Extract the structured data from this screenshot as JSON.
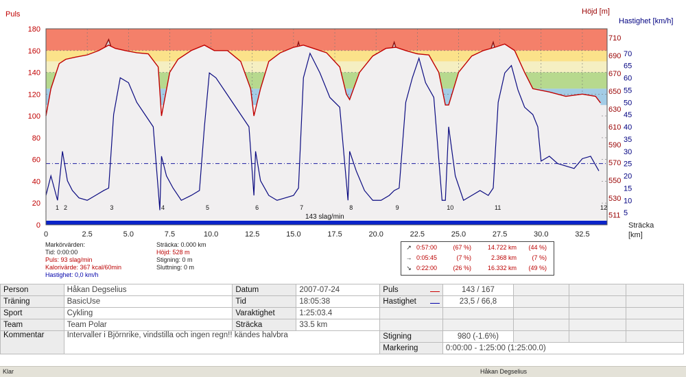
{
  "chart_data": {
    "type": "line",
    "left_axis": {
      "label": "Puls",
      "ticks": [
        0,
        20,
        40,
        60,
        80,
        100,
        120,
        140,
        160,
        180
      ],
      "range": [
        0,
        180
      ],
      "color": "#c00000"
    },
    "right_axis_height": {
      "label": "Höjd [m]",
      "ticks": [
        511,
        530,
        550,
        570,
        590,
        610,
        630,
        650,
        670,
        690,
        710
      ],
      "color": "#990000"
    },
    "right_axis_speed": {
      "label": "Hastighet [km/h]",
      "ticks": [
        5,
        10,
        15,
        20,
        25,
        30,
        35,
        40,
        45,
        50,
        55,
        60,
        65,
        70
      ],
      "range": [
        0,
        80
      ],
      "color": "#000080"
    },
    "x_axis": {
      "label": "Sträcka\n[km]",
      "ticks": [
        "0",
        "2.5",
        "5.0",
        "7.5",
        "10.0",
        "12.5",
        "15.0",
        "17.5",
        "20.0",
        "22.5",
        "25.0",
        "27.5",
        "30.0",
        "32.5"
      ],
      "range": [
        0,
        34
      ]
    },
    "hr_zones": [
      {
        "from": 160,
        "to": 180,
        "color": "#f4806a"
      },
      {
        "from": 150,
        "to": 160,
        "color": "#fbe28a"
      },
      {
        "from": 140,
        "to": 150,
        "color": "#f5efc2"
      },
      {
        "from": 125,
        "to": 140,
        "color": "#b7d98e"
      },
      {
        "from": 110,
        "to": 125,
        "color": "#a3cce6"
      }
    ],
    "average_speed": 25.0,
    "average_hr_label": "143 slag/min",
    "lap_labels": [
      "1",
      "2",
      "3",
      "4",
      "5",
      "6",
      "7",
      "8",
      "9",
      "10",
      "11",
      "12"
    ],
    "lap_positions_km": [
      0.5,
      1.0,
      3.8,
      6.9,
      9.6,
      12.6,
      15.3,
      18.3,
      21.1,
      24.2,
      27.1,
      33.5
    ],
    "altitude": {
      "x": [
        0,
        1,
        2,
        3.8,
        5,
        6.9,
        8,
        9.6,
        11,
        12.6,
        14,
        15.3,
        16.5,
        18.3,
        19.5,
        21.1,
        22.5,
        24.2,
        25.5,
        27.1,
        28.5,
        30,
        31,
        32,
        33,
        33.5
      ],
      "y": [
        515,
        580,
        640,
        708,
        640,
        515,
        620,
        700,
        620,
        515,
        620,
        705,
        620,
        515,
        620,
        705,
        620,
        515,
        620,
        705,
        610,
        515,
        511,
        511,
        512,
        512
      ]
    },
    "heart_rate": {
      "x": [
        0,
        0.3,
        0.8,
        1.2,
        1.8,
        2.5,
        3.2,
        3.8,
        4.2,
        4.8,
        5.5,
        6.2,
        6.8,
        7.0,
        7.5,
        8.0,
        8.8,
        9.6,
        10.2,
        11.0,
        11.8,
        12.4,
        12.6,
        13.0,
        13.5,
        14.2,
        15.0,
        15.6,
        16.2,
        17.0,
        17.8,
        18.2,
        18.4,
        19.0,
        19.8,
        20.6,
        21.2,
        21.8,
        22.5,
        23.2,
        23.8,
        24.2,
        24.4,
        25.0,
        25.8,
        26.5,
        27.2,
        27.8,
        28.4,
        29.0,
        29.5,
        30.5,
        31.5,
        32.5,
        33.3,
        33.6
      ],
      "y": [
        100,
        125,
        148,
        152,
        154,
        156,
        160,
        165,
        162,
        160,
        158,
        157,
        145,
        100,
        140,
        152,
        160,
        165,
        160,
        160,
        150,
        125,
        100,
        125,
        150,
        158,
        163,
        165,
        162,
        158,
        145,
        120,
        115,
        140,
        155,
        162,
        163,
        160,
        157,
        156,
        140,
        110,
        110,
        140,
        155,
        160,
        163,
        166,
        160,
        140,
        125,
        122,
        118,
        120,
        118,
        112
      ]
    },
    "speed": {
      "x": [
        0,
        0.3,
        0.7,
        1.0,
        1.3,
        1.6,
        2.0,
        2.5,
        3.0,
        3.5,
        3.8,
        4.1,
        4.5,
        5.0,
        5.5,
        6.0,
        6.5,
        6.9,
        7.0,
        7.3,
        7.7,
        8.2,
        8.8,
        9.3,
        9.6,
        9.9,
        10.3,
        10.8,
        11.3,
        11.8,
        12.3,
        12.6,
        12.7,
        13.0,
        13.5,
        14.0,
        14.5,
        15.0,
        15.3,
        15.6,
        16.0,
        16.6,
        17.2,
        17.8,
        18.3,
        18.4,
        18.8,
        19.3,
        19.8,
        20.3,
        20.8,
        21.1,
        21.4,
        21.8,
        22.2,
        22.6,
        23.0,
        23.5,
        24.0,
        24.2,
        24.4,
        24.8,
        25.3,
        25.8,
        26.3,
        26.8,
        27.1,
        27.4,
        27.8,
        28.2,
        28.6,
        29.0,
        29.5,
        29.8,
        30.0,
        30.5,
        31.0,
        31.5,
        32.0,
        32.5,
        33.0,
        33.5
      ],
      "y": [
        12,
        20,
        10,
        30,
        18,
        14,
        11,
        10,
        12,
        14,
        15,
        45,
        60,
        58,
        50,
        45,
        40,
        6,
        28,
        20,
        15,
        10,
        12,
        14,
        40,
        62,
        60,
        55,
        50,
        45,
        40,
        12,
        30,
        18,
        12,
        10,
        11,
        12,
        15,
        60,
        70,
        62,
        52,
        48,
        10,
        30,
        22,
        14,
        10,
        10,
        12,
        14,
        15,
        50,
        60,
        68,
        58,
        52,
        10,
        10,
        40,
        20,
        10,
        12,
        14,
        12,
        15,
        50,
        62,
        65,
        55,
        48,
        45,
        40,
        26,
        28,
        25,
        24,
        23,
        27,
        28,
        22
      ]
    }
  },
  "markers": {
    "title": "Markörvärden:",
    "time": "Tid: 0:00:00",
    "pulse": "Puls: 93 slag/min",
    "calories": "Kalorivärde: 367 kcal/60min",
    "speed": "Hastighet: 0,0 km/h"
  },
  "position_stats": {
    "distance": "Sträcka: 0.000 km",
    "height": "Höjd: 528 m",
    "climb": "Stigning: 0 m",
    "descent": "Sluttning: 0 m"
  },
  "gradient_summary": [
    {
      "icon": "up-arrow",
      "glyph": "↗",
      "time": "0:57:00",
      "pct": "(67 %)",
      "dist": "14.722 km",
      "dpct": "(44 %)"
    },
    {
      "icon": "right-arrow",
      "glyph": "→",
      "time": "0:05:45",
      "pct": "(7 %)",
      "dist": "2.368 km",
      "dpct": "(7 %)"
    },
    {
      "icon": "down-arrow",
      "glyph": "↘",
      "time": "0:22:00",
      "pct": "(26 %)",
      "dist": "16.332 km",
      "dpct": "(49 %)"
    }
  ],
  "info": {
    "person_label": "Person",
    "person_value": "Håkan Degselius",
    "training_label": "Träning",
    "training_value": "BasicUse",
    "sport_label": "Sport",
    "sport_value": "Cykling",
    "team_label": "Team",
    "team_value": "Team Polar",
    "comment_label": "Kommentar",
    "comment_value": "Intervaller i Björnrike, vindstilla och ingen regn!! kändes halvbra",
    "date_label": "Datum",
    "date_value": "2007-07-24",
    "time_label": "Tid",
    "time_value": "18:05:38",
    "duration_label": "Varaktighet",
    "duration_value": "1:25:03.4",
    "distance_label": "Sträcka",
    "distance_value": "33.5 km",
    "pulse_label": "Puls",
    "pulse_value": "143 / 167",
    "speed_label": "Hastighet",
    "speed_value": "23,5 / 66,8",
    "climb_label": "Stigning",
    "climb_value": "980 (-1.6%)",
    "marking_label": "Markering",
    "marking_value": "0:00:00 - 1:25:00 (1:25:00.0)"
  },
  "status": {
    "left": "Klar",
    "right": "Håkan Degselius"
  }
}
